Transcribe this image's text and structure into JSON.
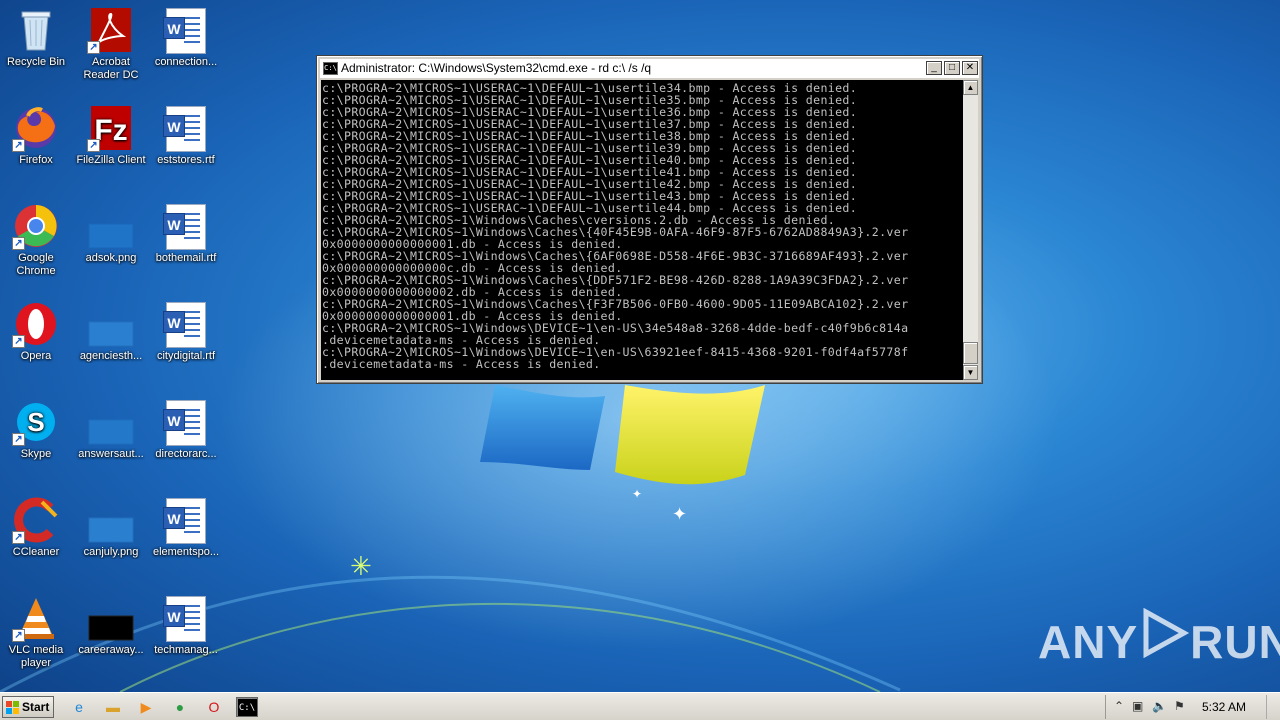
{
  "desktop": {
    "icons": [
      {
        "label": "Recycle Bin",
        "icon": "recycle-bin-icon"
      },
      {
        "label": "Acrobat Reader DC",
        "icon": "acrobat-reader-icon"
      },
      {
        "label": "connection...",
        "icon": "word-document-icon"
      },
      {
        "label": "Firefox",
        "icon": "firefox-icon"
      },
      {
        "label": "FileZilla Client",
        "icon": "filezilla-icon"
      },
      {
        "label": "eststores.rtf",
        "icon": "word-document-icon"
      },
      {
        "label": "Google Chrome",
        "icon": "chrome-icon"
      },
      {
        "label": "adsok.png",
        "icon": "image-file-icon"
      },
      {
        "label": "bothemail.rtf",
        "icon": "word-document-icon"
      },
      {
        "label": "Opera",
        "icon": "opera-icon"
      },
      {
        "label": "agenciesth...",
        "icon": "image-file-icon"
      },
      {
        "label": "citydigital.rtf",
        "icon": "word-document-icon"
      },
      {
        "label": "Skype",
        "icon": "skype-icon"
      },
      {
        "label": "answersaut...",
        "icon": "image-file-icon"
      },
      {
        "label": "directorarc...",
        "icon": "word-document-icon"
      },
      {
        "label": "CCleaner",
        "icon": "ccleaner-icon"
      },
      {
        "label": "canjuly.png",
        "icon": "image-file-icon"
      },
      {
        "label": "elementspo...",
        "icon": "word-document-icon"
      },
      {
        "label": "VLC media player",
        "icon": "vlc-icon"
      },
      {
        "label": "careeraway...",
        "icon": "image-file-icon"
      },
      {
        "label": "techmanag...",
        "icon": "word-document-icon"
      }
    ]
  },
  "cmd_window": {
    "title": "Administrator: C:\\Windows\\System32\\cmd.exe - rd  c:\\ /s /q",
    "icon_text": "C:\\",
    "minimize": "_",
    "maximize": "□",
    "close": "✕",
    "lines": [
      "c:\\PROGRA~2\\MICROS~1\\USERAC~1\\DEFAUL~1\\usertile34.bmp - Access is denied.",
      "c:\\PROGRA~2\\MICROS~1\\USERAC~1\\DEFAUL~1\\usertile35.bmp - Access is denied.",
      "c:\\PROGRA~2\\MICROS~1\\USERAC~1\\DEFAUL~1\\usertile36.bmp - Access is denied.",
      "c:\\PROGRA~2\\MICROS~1\\USERAC~1\\DEFAUL~1\\usertile37.bmp - Access is denied.",
      "c:\\PROGRA~2\\MICROS~1\\USERAC~1\\DEFAUL~1\\usertile38.bmp - Access is denied.",
      "c:\\PROGRA~2\\MICROS~1\\USERAC~1\\DEFAUL~1\\usertile39.bmp - Access is denied.",
      "c:\\PROGRA~2\\MICROS~1\\USERAC~1\\DEFAUL~1\\usertile40.bmp - Access is denied.",
      "c:\\PROGRA~2\\MICROS~1\\USERAC~1\\DEFAUL~1\\usertile41.bmp - Access is denied.",
      "c:\\PROGRA~2\\MICROS~1\\USERAC~1\\DEFAUL~1\\usertile42.bmp - Access is denied.",
      "c:\\PROGRA~2\\MICROS~1\\USERAC~1\\DEFAUL~1\\usertile43.bmp - Access is denied.",
      "c:\\PROGRA~2\\MICROS~1\\USERAC~1\\DEFAUL~1\\usertile44.bmp - Access is denied.",
      "c:\\PROGRA~2\\MICROS~1\\Windows\\Caches\\cversions.2.db - Access is denied.",
      "c:\\PROGRA~2\\MICROS~1\\Windows\\Caches\\{40F45E9B-0AFA-46F9-87F5-6762AD8849A3}.2.ver",
      "0x0000000000000001.db - Access is denied.",
      "c:\\PROGRA~2\\MICROS~1\\Windows\\Caches\\{6AF0698E-D558-4F6E-9B3C-3716689AF493}.2.ver",
      "0x000000000000000c.db - Access is denied.",
      "c:\\PROGRA~2\\MICROS~1\\Windows\\Caches\\{DDF571F2-BE98-426D-8288-1A9A39C3FDA2}.2.ver",
      "0x0000000000000002.db - Access is denied.",
      "c:\\PROGRA~2\\MICROS~1\\Windows\\Caches\\{F3F7B506-0FB0-4600-9D05-11E09ABCA102}.2.ver",
      "0x0000000000000001.db - Access is denied.",
      "c:\\PROGRA~2\\MICROS~1\\Windows\\DEVICE~1\\en-US\\34e548a8-3268-4dde-bedf-c40f9b6c814a",
      ".devicemetadata-ms - Access is denied.",
      "c:\\PROGRA~2\\MICROS~1\\Windows\\DEVICE~1\\en-US\\63921eef-8415-4368-9201-f0df4af5778f",
      ".devicemetadata-ms - Access is denied."
    ]
  },
  "watermark": {
    "left": "ANY",
    "right": "RUN"
  },
  "taskbar": {
    "start_label": "Start",
    "pinned": [
      {
        "name": "internet-explorer-icon",
        "glyph": "e",
        "color": "#1e88d8"
      },
      {
        "name": "explorer-folder-icon",
        "glyph": "▬",
        "color": "#d9a32e"
      },
      {
        "name": "media-player-icon",
        "glyph": "▶",
        "color": "#f08a1c"
      },
      {
        "name": "chrome-icon",
        "glyph": "●",
        "color": "#2e9b45"
      },
      {
        "name": "opera-icon",
        "glyph": "O",
        "color": "#d7151b"
      },
      {
        "name": "cmd-icon",
        "glyph": "C:\\",
        "color": "#000000"
      }
    ],
    "tray": {
      "clock": "5:32 AM"
    }
  },
  "colors": {
    "console_bg": "#000000",
    "console_fg": "#c0c0c0",
    "wallpaper_blue": "#1a63b6",
    "taskbar": "#d6d3cb"
  }
}
